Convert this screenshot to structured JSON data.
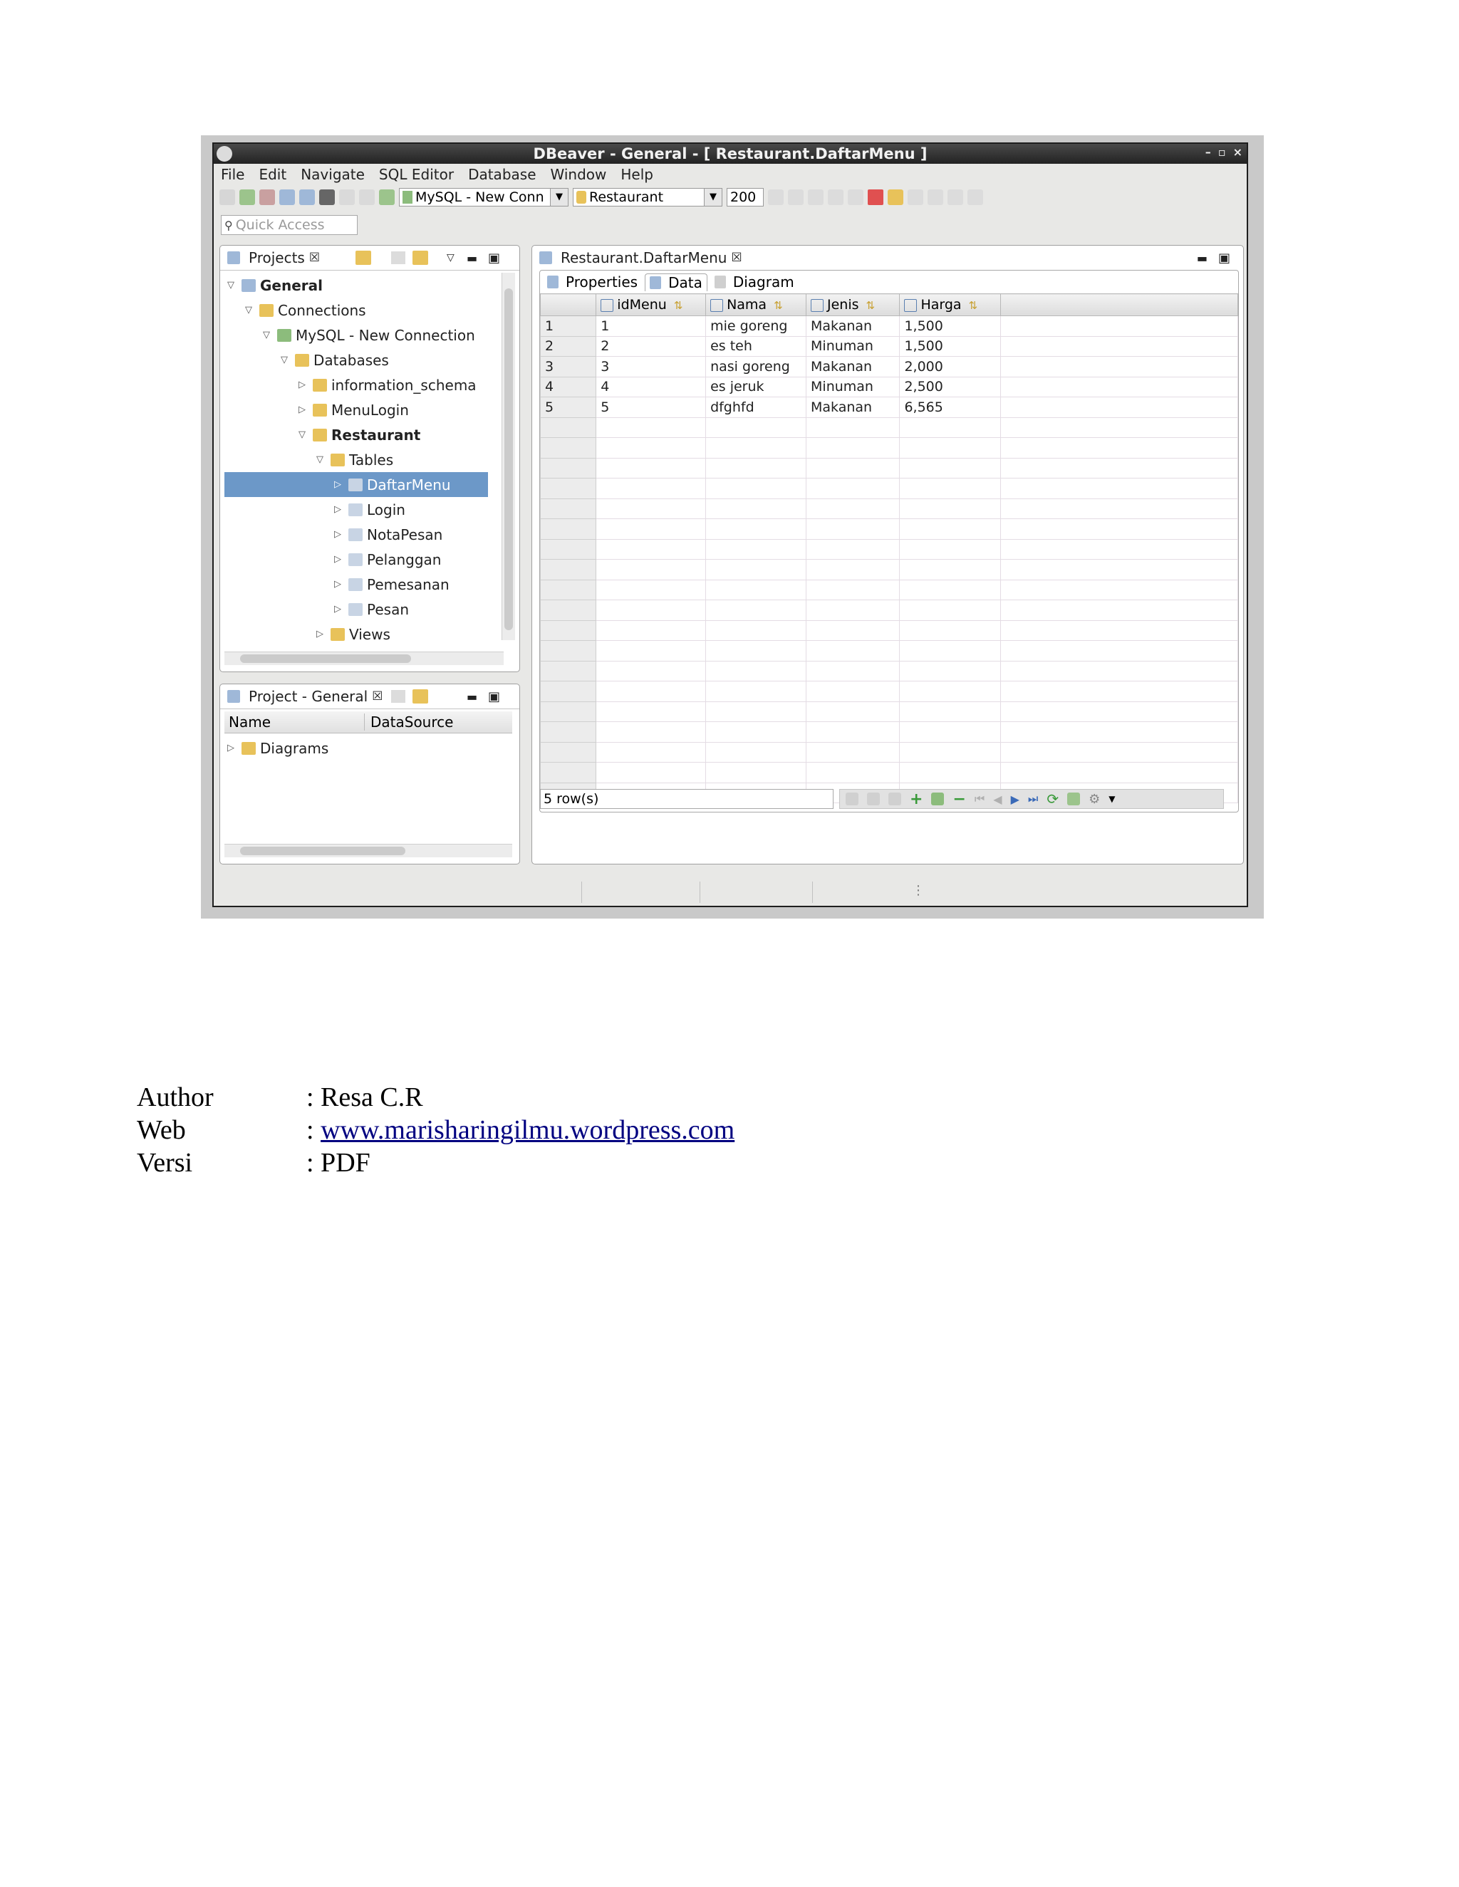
{
  "window": {
    "title": "DBeaver - General - [ Restaurant.DaftarMenu ]",
    "controls": [
      "–",
      "▫",
      "×"
    ]
  },
  "menubar": [
    "File",
    "Edit",
    "Navigate",
    "SQL Editor",
    "Database",
    "Window",
    "Help"
  ],
  "toolbar": {
    "connection": "MySQL - New Conn",
    "database": "Restaurant",
    "fetch_size": "200"
  },
  "quick_access": {
    "placeholder": "Quick Access"
  },
  "projects_panel": {
    "tab": "Projects",
    "tree": [
      {
        "label": "General",
        "level": 0,
        "bold": true,
        "expanded": true
      },
      {
        "label": "Connections",
        "level": 1,
        "expanded": true
      },
      {
        "label": "MySQL - New Connection",
        "level": 2,
        "expanded": true
      },
      {
        "label": "Databases",
        "level": 3,
        "expanded": true
      },
      {
        "label": "information_schema",
        "level": 4,
        "expanded": false
      },
      {
        "label": "MenuLogin",
        "level": 4,
        "expanded": false
      },
      {
        "label": "Restaurant",
        "level": 4,
        "bold": true,
        "expanded": true
      },
      {
        "label": "Tables",
        "level": 5,
        "expanded": true
      },
      {
        "label": "DaftarMenu",
        "level": 6,
        "expanded": false,
        "selected": true
      },
      {
        "label": "Login",
        "level": 6,
        "expanded": false
      },
      {
        "label": "NotaPesan",
        "level": 6,
        "expanded": false
      },
      {
        "label": "Pelanggan",
        "level": 6,
        "expanded": false
      },
      {
        "label": "Pemesanan",
        "level": 6,
        "expanded": false
      },
      {
        "label": "Pesan",
        "level": 6,
        "expanded": false
      },
      {
        "label": "Views",
        "level": 5,
        "expanded": false
      }
    ]
  },
  "project_general_panel": {
    "tab": "Project - General",
    "columns": [
      "Name",
      "DataSource"
    ],
    "items": [
      "Diagrams"
    ]
  },
  "editor": {
    "tab": "Restaurant.DaftarMenu",
    "subtabs": [
      "Properties",
      "Data",
      "Diagram"
    ],
    "active_subtab": "Data",
    "columns": [
      "idMenu",
      "Nama",
      "Jenis",
      "Harga"
    ],
    "rows": [
      {
        "n": "1",
        "cells": [
          "1",
          "mie goreng",
          "Makanan",
          "1,500"
        ]
      },
      {
        "n": "2",
        "cells": [
          "2",
          "es teh",
          "Minuman",
          "1,500"
        ]
      },
      {
        "n": "3",
        "cells": [
          "3",
          "nasi goreng",
          "Makanan",
          "2,000"
        ]
      },
      {
        "n": "4",
        "cells": [
          "4",
          "es jeruk",
          "Minuman",
          "2,500"
        ]
      },
      {
        "n": "5",
        "cells": [
          "5",
          "dfghfd",
          "Makanan",
          "6,565"
        ]
      }
    ],
    "status": "5 row(s)"
  },
  "info": {
    "author_label": "Author",
    "author_value": ": Resa C.R",
    "web_label": "Web",
    "web_prefix": ": ",
    "web_link": "www.marisharingilmu.wordpress.com",
    "version_label": "Versi",
    "version_value": ": PDF"
  },
  "colors": {
    "selection": "#6c98c8",
    "titlebar": "#2c2c2c",
    "link": "#000080"
  }
}
